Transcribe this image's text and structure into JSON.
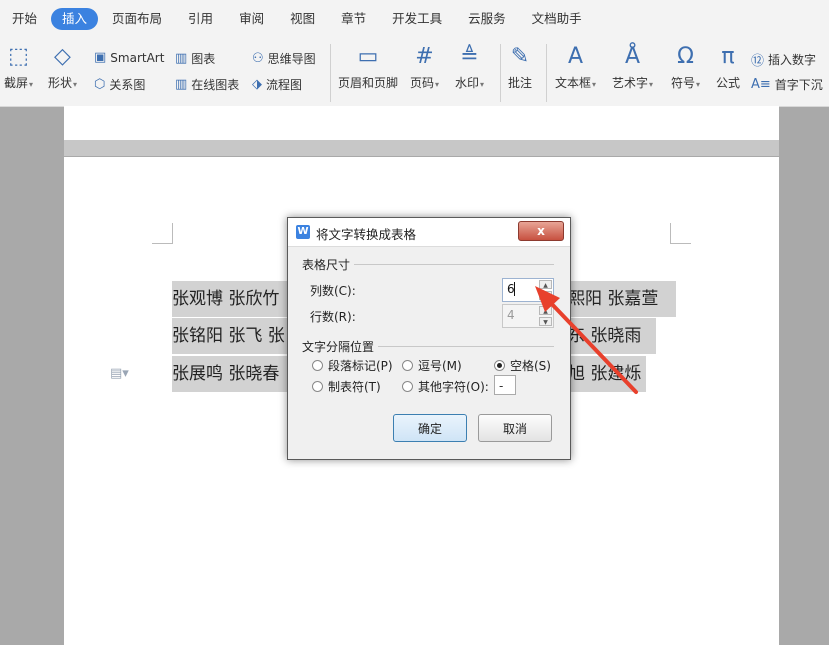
{
  "menu": {
    "items": [
      {
        "label": "开始",
        "active": false
      },
      {
        "label": "插入",
        "active": true
      },
      {
        "label": "页面布局",
        "active": false
      },
      {
        "label": "引用",
        "active": false
      },
      {
        "label": "审阅",
        "active": false
      },
      {
        "label": "视图",
        "active": false
      },
      {
        "label": "章节",
        "active": false
      },
      {
        "label": "开发工具",
        "active": false
      },
      {
        "label": "云服务",
        "active": false
      },
      {
        "label": "文档助手",
        "active": false
      }
    ]
  },
  "ribbon": {
    "screenshot": "截屏",
    "shape": "形状",
    "smartart": "SmartArt",
    "relation": "关系图",
    "chart": "图表",
    "online_chart": "在线图表",
    "mindmap": "思维导图",
    "flowchart": "流程图",
    "header_footer": "页眉和页脚",
    "page_number": "页码",
    "watermark": "水印",
    "comment": "批注",
    "textbox": "文本框",
    "wordart": "艺术字",
    "symbol": "符号",
    "formula": "公式",
    "insert_number": "插入数字",
    "drop_cap": "首字下沉"
  },
  "document": {
    "lines": [
      {
        "left": "张观博  张欣竹",
        "right": "熙阳  张嘉萱"
      },
      {
        "left": "张铭阳  张飞  张",
        "right": "东  张晓雨"
      },
      {
        "left": "张展鸣  张晓春",
        "right": "旭  张建烁"
      }
    ]
  },
  "dialog": {
    "title": "将文字转换成表格",
    "close_label": "x",
    "size_group": "表格尺寸",
    "columns_label": "列数(C):",
    "columns_value": "6",
    "rows_label": "行数(R):",
    "rows_value": "4",
    "sep_group": "文字分隔位置",
    "opt_paragraph": "段落标记(P)",
    "opt_comma": "逗号(M)",
    "opt_space": "空格(S)",
    "opt_tab": "制表符(T)",
    "opt_other": "其他字符(O):",
    "other_char": "-",
    "ok": "确定",
    "cancel": "取消"
  },
  "colors": {
    "accent": "#3b82e0",
    "arrow": "#e8402c",
    "selection": "#d2d2d2"
  }
}
